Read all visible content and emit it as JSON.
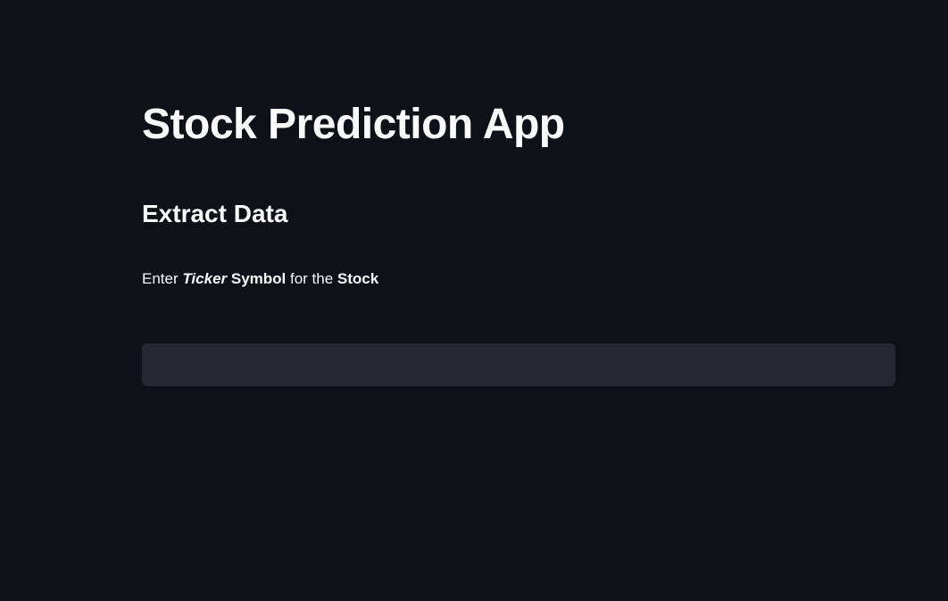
{
  "page": {
    "title": "Stock Prediction App",
    "section_heading": "Extract Data"
  },
  "prompt": {
    "part1": "Enter ",
    "part2_italic_bold": "Ticker",
    "part3_bold": " Symbol",
    "part4": " for the ",
    "part5_bold": "Stock"
  },
  "ticker_input": {
    "value": "",
    "placeholder": ""
  },
  "colors": {
    "background": "#0e1117",
    "text": "#fafafa",
    "input_background": "#262730"
  }
}
